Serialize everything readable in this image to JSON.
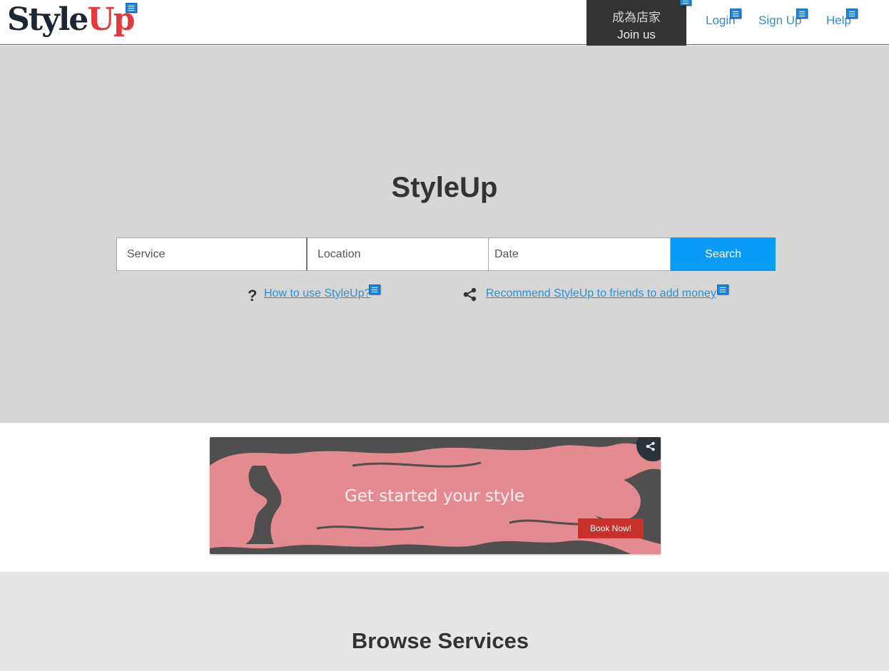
{
  "header": {
    "logo_part1": "Style",
    "logo_part2": "Up",
    "join_zh": "成為店家",
    "join_en": "Join us",
    "nav": {
      "login": "Login",
      "signup": "Sign Up",
      "help": "Help"
    }
  },
  "hero": {
    "title": "StyleUp",
    "search": {
      "service_placeholder": "Service",
      "location_placeholder": "Location",
      "date_placeholder": "Date",
      "button": "Search"
    },
    "links": {
      "how_to": "How to use StyleUp?",
      "recommend": "Recommend StyleUp to friends to add money"
    }
  },
  "banner": {
    "tagline": "Get started your style",
    "cta": "Book Now!"
  },
  "browse": {
    "title": "Browse Services"
  },
  "colors": {
    "accent": "#0a9bf7",
    "link": "#2b8fd0",
    "hero_bg": "#d6d6d6",
    "banner_pink": "#e38b91",
    "cta_red": "#c8312b"
  }
}
